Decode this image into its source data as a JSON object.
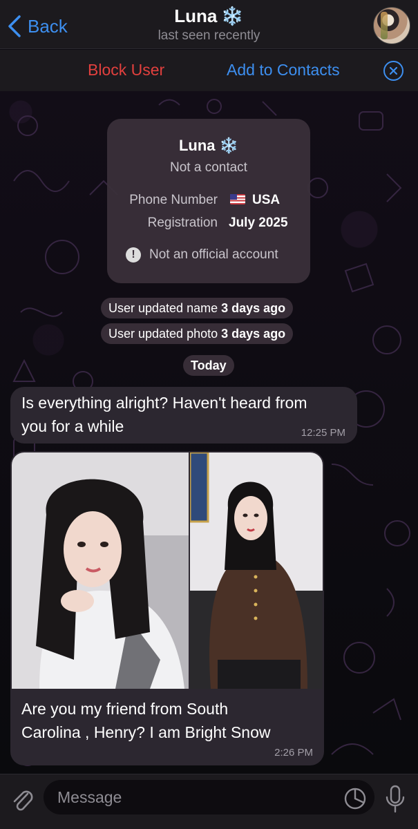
{
  "header": {
    "back_label": "Back",
    "contact_name": "Luna",
    "name_emoji": "❄️",
    "status": "last seen recently"
  },
  "actions": {
    "block_label": "Block User",
    "add_label": "Add to Contacts"
  },
  "info_card": {
    "name": "Luna",
    "name_emoji": "❄️",
    "subtitle": "Not a contact",
    "phone_label": "Phone Number",
    "phone_value": "USA",
    "registration_label": "Registration",
    "registration_value": "July 2025",
    "warning": "Not an official account"
  },
  "service_messages": [
    {
      "text": "User updated name",
      "when": "3 days ago"
    },
    {
      "text": "User updated photo",
      "when": "3 days ago"
    }
  ],
  "date_separator": "Today",
  "messages": [
    {
      "text_line1": "Is everything alright? Haven't heard from",
      "text_line2": "you for a while",
      "time": "12:25 PM"
    },
    {
      "text_line1": "Are you my friend from South",
      "text_line2": "Carolina , Henry? I am Bright Snow",
      "time": "2:26 PM"
    }
  ],
  "input": {
    "placeholder": "Message"
  },
  "colors": {
    "accent_blue": "#3d8ff0",
    "danger_red": "#e2403e",
    "bar_bg": "#1c1a1e",
    "bubble_bg": "#2c2730"
  },
  "icons": {
    "back": "chevron-left-icon",
    "close": "close-circle-icon",
    "warning": "exclamation-circle-icon",
    "attach": "paperclip-icon",
    "sticker": "sticker-icon",
    "mic": "microphone-icon"
  }
}
